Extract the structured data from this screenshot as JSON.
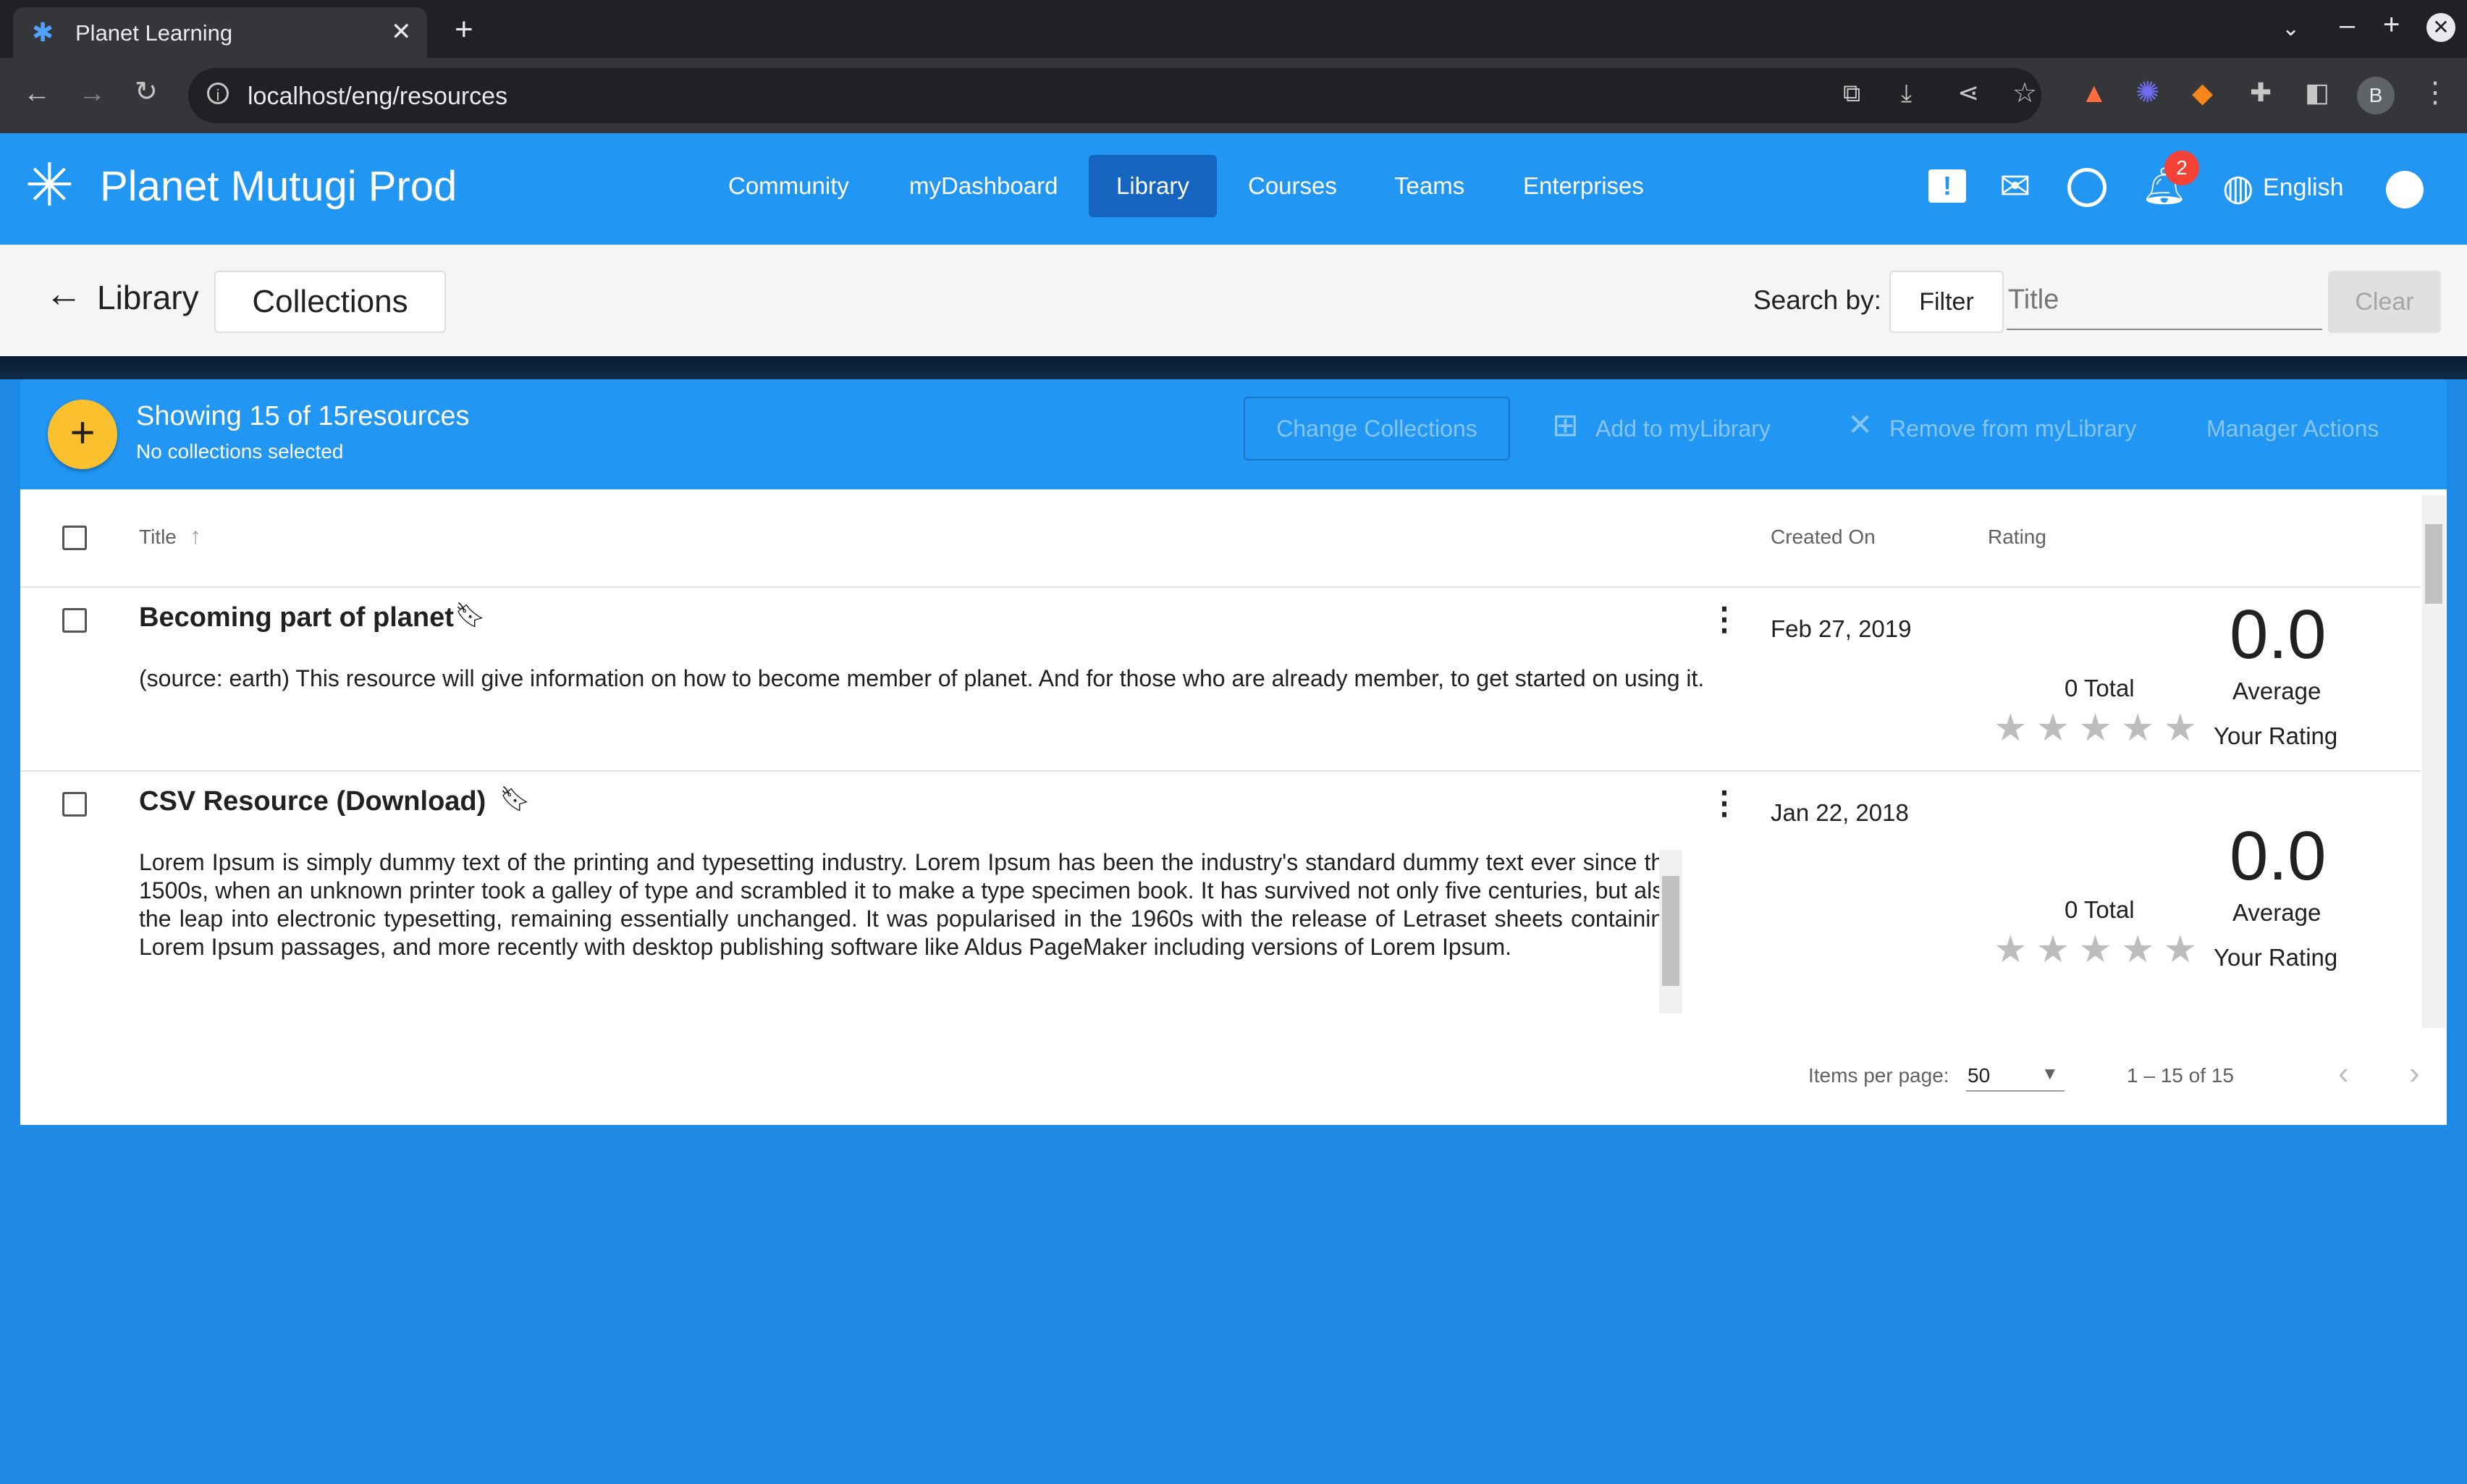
{
  "browser": {
    "tab_title": "Planet Learning",
    "url": "localhost/eng/resources",
    "profile_initial": "B"
  },
  "app": {
    "brand": "Planet Mutugi Prod",
    "nav": [
      "Community",
      "myDashboard",
      "Library",
      "Courses",
      "Teams",
      "Enterprises"
    ],
    "active_nav": "Library",
    "notification_count": "2",
    "language": "English"
  },
  "subheader": {
    "title": "Library",
    "collections_button": "Collections",
    "search_by_label": "Search by:",
    "filter_button": "Filter",
    "search_placeholder": "Title",
    "clear_button": "Clear"
  },
  "selection_bar": {
    "showing": "Showing 15 of 15resources",
    "subtitle": "No collections selected",
    "change_collections": "Change Collections",
    "add_to_mylibrary": "Add to myLibrary",
    "remove_from_mylibrary": "Remove from myLibrary",
    "manager_actions": "Manager Actions"
  },
  "table": {
    "headers": {
      "title": "Title",
      "created_on": "Created On",
      "rating": "Rating"
    },
    "rows": [
      {
        "title": "Becoming part of planet",
        "description": "(source: earth) This resource will give information on how to become member of planet. And for those who are already member, to get started on using it.",
        "created_on": "Feb 27, 2019",
        "average": "0.0",
        "total": "0 Total",
        "average_label": "Average",
        "your_rating": "Your Rating"
      },
      {
        "title": "CSV Resource (Download)",
        "description": "Lorem Ipsum is simply dummy text of the printing and typesetting industry. Lorem Ipsum has been the industry's standard dummy text ever since the 1500s, when an unknown printer took a galley of type and scrambled it to make a type specimen book. It has survived not only five centuries, but also the leap into electronic typesetting, remaining essentially unchanged. It was popularised in the 1960s with the release of Letraset sheets containing Lorem Ipsum passages, and more recently with desktop publishing software like Aldus PageMaker including versions of Lorem Ipsum.",
        "created_on": "Jan 22, 2018",
        "average": "0.0",
        "total": "0 Total",
        "average_label": "Average",
        "your_rating": "Your Rating"
      }
    ]
  },
  "paginator": {
    "items_per_page_label": "Items per page:",
    "items_per_page": "50",
    "range": "1 – 15 of 15"
  }
}
